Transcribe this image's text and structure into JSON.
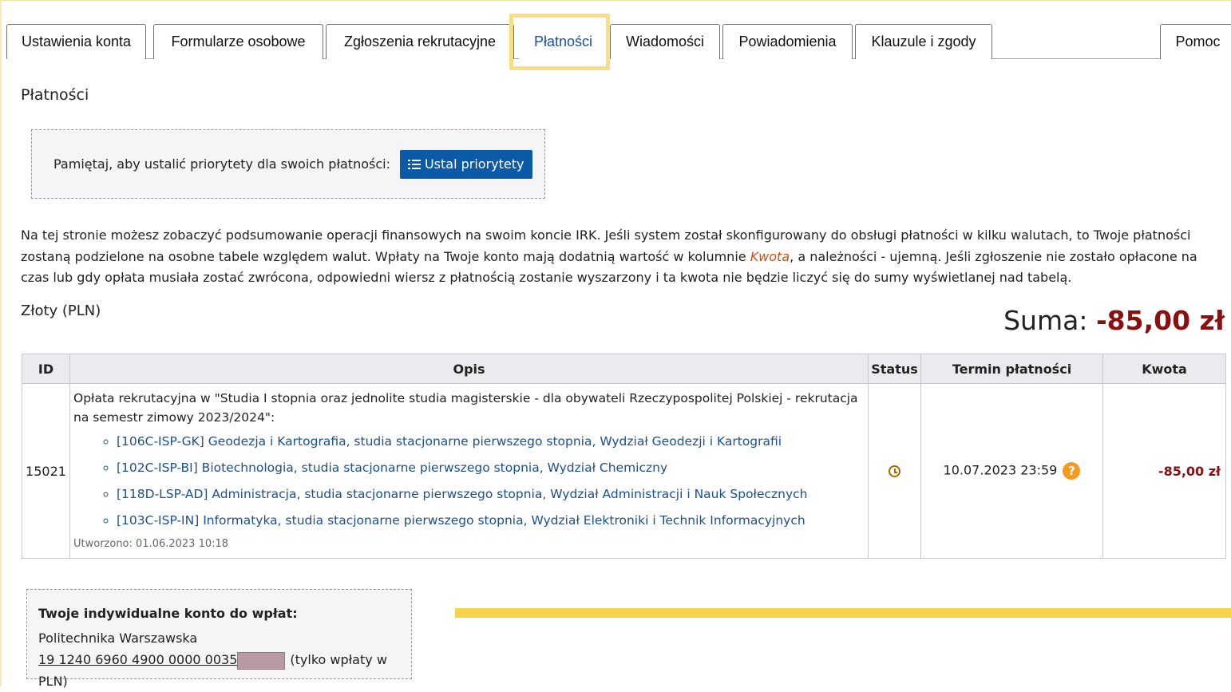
{
  "tabs": [
    {
      "label": "Ustawienia konta"
    },
    {
      "label": "Formularze osobowe"
    },
    {
      "label": "Zgłoszenia rekrutacyjne"
    },
    {
      "label": "Płatności",
      "active": true
    },
    {
      "label": "Wiadomości"
    },
    {
      "label": "Powiadomienia"
    },
    {
      "label": "Klauzule i zgody"
    },
    {
      "label": "Pomoc"
    }
  ],
  "page": {
    "title": "Płatności",
    "priority_text": "Pamiętaj, aby ustalić priorytety dla swoich płatności:",
    "priority_button": "Ustal priorytety",
    "info_part1": "Na tej stronie możesz zobaczyć podsumowanie operacji finansowych na swoim koncie IRK. Jeśli system został skonfigurowany do obsługi płatności w kilku walutach, to Twoje płatności zostaną podzielone na osobne tabele względem walut. Wpłaty na Twoje konto mają dodatnią wartość w kolumnie ",
    "info_emphasis": "Kwota",
    "info_part2": ", a należności - ujemną. Jeśli zgłoszenie nie zostało opłacone na czas lub gdy opłata musiała zostać zwrócona, odpowiedni wiersz z płatnością zostanie wyszarzony i ta kwota nie będzie liczyć się do sumy wyświetlanej nad tabelą.",
    "currency_title": "Złoty (PLN)",
    "sum_label": "Suma:",
    "sum_value": "-85,00 zł"
  },
  "table": {
    "headers": {
      "id": "ID",
      "desc": "Opis",
      "status": "Status",
      "deadline": "Termin płatności",
      "amount": "Kwota"
    },
    "row": {
      "id": "15021",
      "description": "Opłata rekrutacyjna w \"Studia I stopnia oraz jednolite studia magisterskie - dla obywateli Rzeczypospolitej Polskiej - rekrutacja na semestr zimowy 2023/2024\":",
      "programs": [
        "[106C-ISP-GK] Geodezja i Kartografia, studia stacjonarne pierwszego stopnia, Wydział Geodezji i Kartografii",
        "[102C-ISP-BI] Biotechnologia, studia stacjonarne pierwszego stopnia, Wydział Chemiczny",
        "[118D-LSP-AD] Administracja, studia stacjonarne pierwszego stopnia, Wydział Administracji i Nauk Społecznych",
        "[103C-ISP-IN] Informatyka, studia stacjonarne pierwszego stopnia, Wydział Elektroniki i Technik Informacyjnych"
      ],
      "created": "Utworzono: 01.06.2023 10:18",
      "status_icon": "clock-icon",
      "deadline": "10.07.2023 23:59",
      "amount": "-85,00 zł"
    }
  },
  "account": {
    "label": "Twoje indywidualne konto do wpłat:",
    "bank": "Politechnika Warszawska",
    "number": "19 1240 6960 4900 0000 0035",
    "note": "(tylko wpłaty w PLN)"
  },
  "colors": {
    "accent_blue": "#0b5aa8",
    "negative_amount": "#8b0f0f",
    "highlight_yellow": "#f8df83"
  }
}
